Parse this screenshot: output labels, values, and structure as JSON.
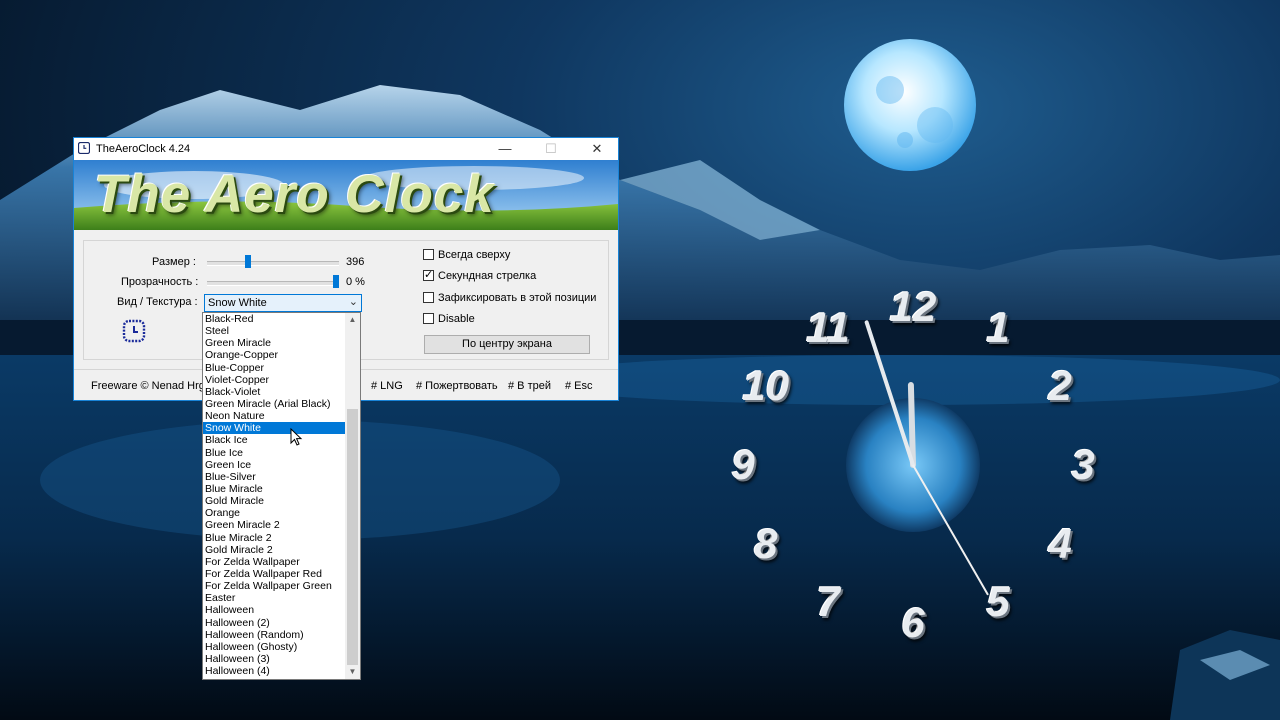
{
  "window": {
    "title": "TheAeroClock 4.24",
    "banner_text": "The Aero Clock"
  },
  "settings": {
    "size_label": "Размер :",
    "size_value": "396",
    "size_level": 0.3,
    "transparency_label": "Прозрачность :",
    "transparency_value": "0 %",
    "transparency_level": 1.0,
    "texture_label": "Вид / Текстура :",
    "texture_selected": "Snow White"
  },
  "checkboxes": [
    {
      "label": "Всегда сверху",
      "checked": false
    },
    {
      "label": "Секундная стрелка",
      "checked": true
    },
    {
      "label": "Зафиксировать в этой позиции",
      "checked": false
    },
    {
      "label": "Disable",
      "checked": false
    }
  ],
  "center_button": "По центру экрана",
  "footer": {
    "freeware": "Freeware © Nenad Hrg 2",
    "lng": "# LNG",
    "donate": "# Пожертвовать",
    "tray": "# В трей",
    "esc": "# Esc"
  },
  "dropdown": {
    "selected_index": 9,
    "options": [
      "Black-Red",
      "Steel",
      "Green Miracle",
      "Orange-Copper",
      "Blue-Copper",
      "Violet-Copper",
      "Black-Violet",
      "Green Miracle (Arial Black)",
      "Neon Nature",
      "Snow White",
      "Black Ice",
      "Blue Ice",
      "Green Ice",
      "Blue-Silver",
      "Blue Miracle",
      "Gold Miracle",
      "Orange",
      "Green Miracle 2",
      "Blue Miracle 2",
      "Gold Miracle 2",
      "For Zelda Wallpaper",
      "For Zelda Wallpaper Red",
      "For Zelda Wallpaper Green",
      "Easter",
      "Halloween",
      "Halloween (2)",
      "Halloween (Random)",
      "Halloween (Ghosty)",
      "Halloween (3)",
      "Halloween (4)"
    ]
  },
  "clock": {
    "numerals": [
      "12",
      "1",
      "2",
      "3",
      "4",
      "5",
      "6",
      "7",
      "8",
      "9",
      "10",
      "11"
    ],
    "time_hours": 11.95,
    "time_seconds": 25,
    "color": "#e8ecf0"
  },
  "colors": {
    "accent": "#0078d7",
    "sky": "#0b2a4a",
    "moon": "#6ec6ff"
  },
  "icons": {
    "app": "clock-icon",
    "minimize": "minimize-icon",
    "maximize": "maximize-icon",
    "close": "close-icon",
    "cursor": "mouse-cursor-icon"
  }
}
